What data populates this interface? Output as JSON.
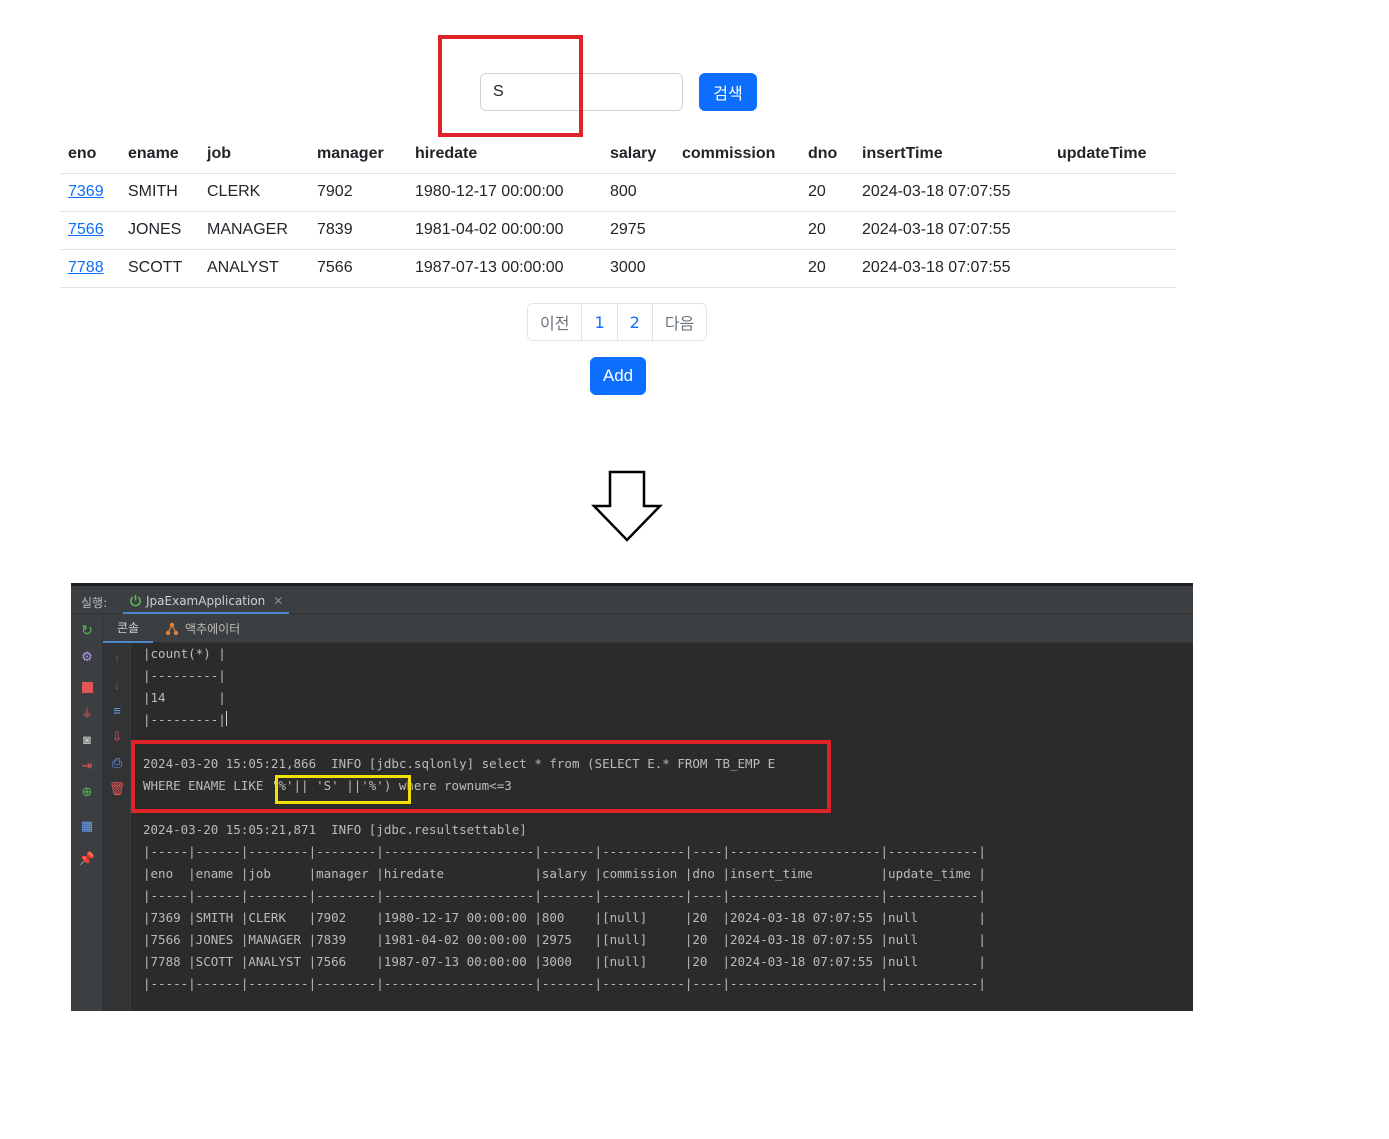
{
  "search": {
    "value": "S",
    "button_label": "검색"
  },
  "table": {
    "columns": [
      "eno",
      "ename",
      "job",
      "manager",
      "hiredate",
      "salary",
      "commission",
      "dno",
      "insertTime",
      "updateTime"
    ],
    "rows": [
      [
        "7369",
        "SMITH",
        "CLERK",
        "7902",
        "1980-12-17 00:00:00",
        "800",
        "",
        "20",
        "2024-03-18 07:07:55",
        ""
      ],
      [
        "7566",
        "JONES",
        "MANAGER",
        "7839",
        "1981-04-02 00:00:00",
        "2975",
        "",
        "20",
        "2024-03-18 07:07:55",
        ""
      ],
      [
        "7788",
        "SCOTT",
        "ANALYST",
        "7566",
        "1987-07-13 00:00:00",
        "3000",
        "",
        "20",
        "2024-03-18 07:07:55",
        ""
      ]
    ]
  },
  "pagination": {
    "prev": "이전",
    "pages": [
      "1",
      "2"
    ],
    "next": "다음"
  },
  "add_button": "Add",
  "ide": {
    "run_label": "실행:",
    "run_tab": "JpaExamApplication",
    "console_tab": "콘솔",
    "actuator_tab": "액추에이터",
    "lines": [
      "|count(*) |",
      "|---------|",
      "|14       |",
      "|---------|",
      "",
      "2024-03-20 15:05:21,866  INFO [jdbc.sqlonly] select * from (SELECT E.* FROM TB_EMP E",
      "WHERE ENAME LIKE '%'|| 'S' ||'%') where rownum<=3",
      "",
      "2024-03-20 15:05:21,871  INFO [jdbc.resultsettable]",
      "|-----|------|--------|--------|--------------------|-------|-----------|----|--------------------|------------|",
      "|eno  |ename |job     |manager |hiredate            |salary |commission |dno |insert_time         |update_time |",
      "|-----|------|--------|--------|--------------------|-------|-----------|----|--------------------|------------|",
      "|7369 |SMITH |CLERK   |7902    |1980-12-17 00:00:00 |800    |[null]     |20  |2024-03-18 07:07:55 |null        |",
      "|7566 |JONES |MANAGER |7839    |1981-04-02 00:00:00 |2975   |[null]     |20  |2024-03-18 07:07:55 |null        |",
      "|7788 |SCOTT |ANALYST |7566    |1987-07-13 00:00:00 |3000   |[null]     |20  |2024-03-18 07:07:55 |null        |",
      "|-----|------|--------|--------|--------------------|-------|-----------|----|--------------------|------------|"
    ]
  },
  "colors": {
    "primary": "#0d6efd",
    "highlight_red": "#e0232a",
    "highlight_yellow": "#f2e000",
    "console_bg": "#2b2b2b"
  }
}
